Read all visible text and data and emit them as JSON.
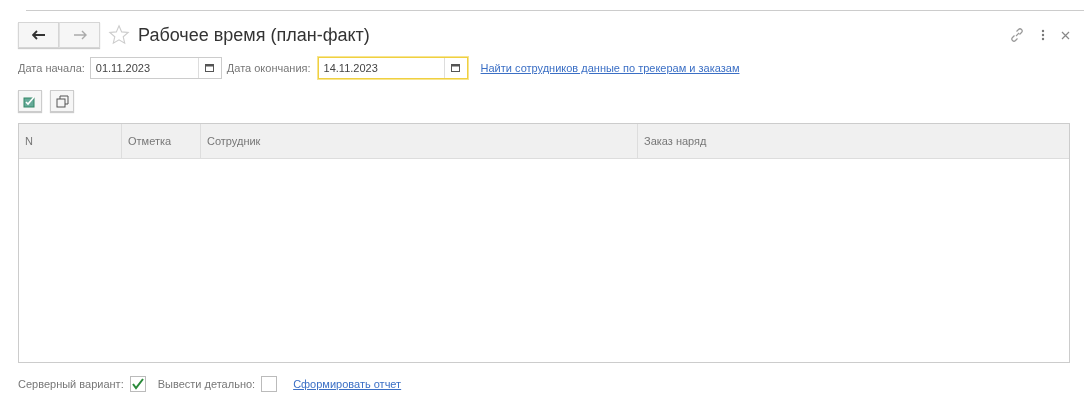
{
  "window": {
    "title": "Рабочее время (план-факт)"
  },
  "filters": [
    {
      "label": "Дата начала:",
      "value": "01.11.2023",
      "focused": false
    },
    {
      "label": "Дата окончания:",
      "value": "14.11.2023",
      "focused": true
    }
  ],
  "find_link": "Найти сотрудников данные по трекерам и заказам",
  "table": {
    "columns": [
      "N",
      "Отметка",
      "Сотрудник",
      "Заказ наряд"
    ]
  },
  "options": [
    {
      "label": "Серверный вариант:",
      "checked": true
    },
    {
      "label": "Вывести детально:",
      "checked": false
    }
  ],
  "report_link": "Сформировать отчет"
}
